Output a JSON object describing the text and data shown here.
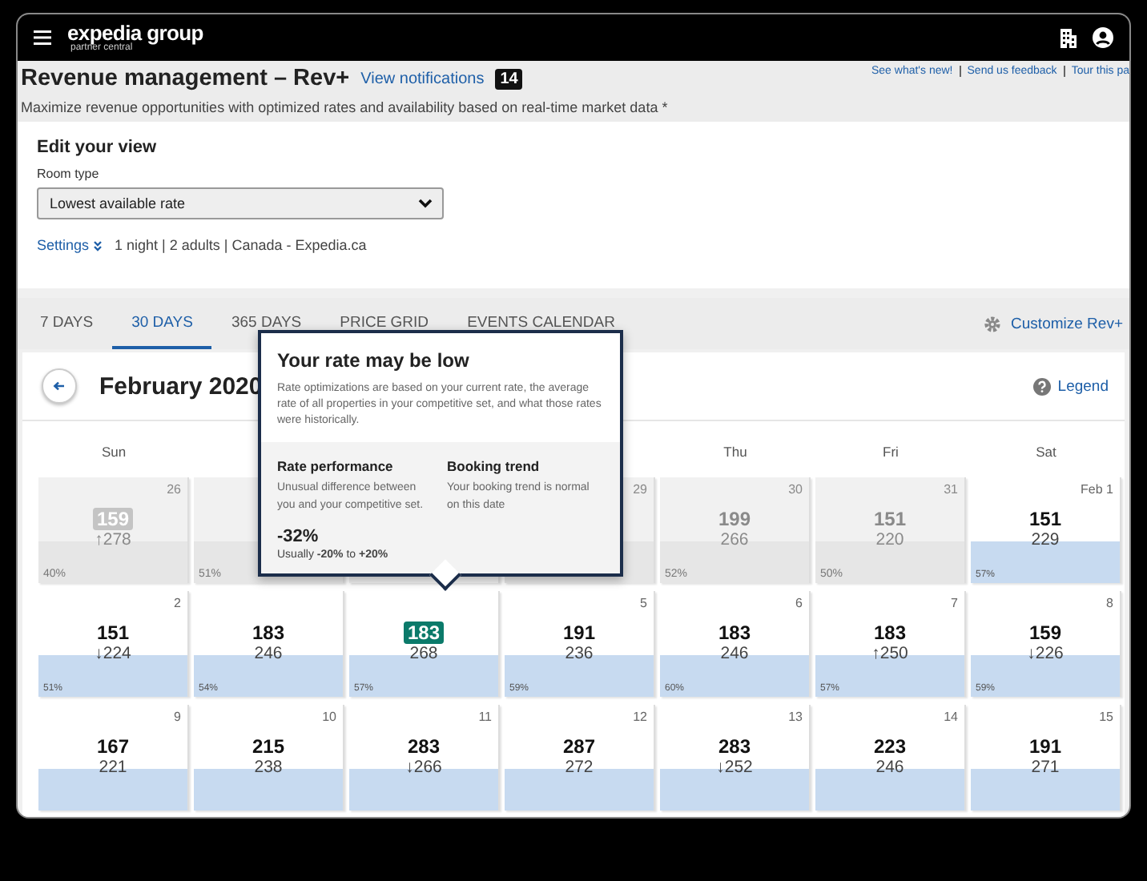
{
  "topbar": {
    "logo": "expedia group",
    "sublabel": "partner central"
  },
  "header": {
    "title": "Revenue management – Rev+",
    "notifications_link": "View notifications",
    "notifications_count": "14",
    "links": [
      "See what's new!",
      "Send us feedback",
      "Tour this pa"
    ],
    "subtitle": "Maximize revenue opportunities with optimized rates and availability based on real-time market data *"
  },
  "edit_view": {
    "title": "Edit your view",
    "room_type_label": "Room type",
    "room_type_value": "Lowest available rate",
    "settings_link": "Settings",
    "settings_summary": "1 night | 2 adults | Canada - Expedia.ca"
  },
  "tabs": [
    {
      "label": "7 DAYS",
      "selected": false
    },
    {
      "label": "30 DAYS",
      "selected": true
    },
    {
      "label": "365 DAYS",
      "selected": false
    },
    {
      "label": "PRICE GRID",
      "selected": false
    },
    {
      "label": "EVENTS CALENDAR",
      "selected": false
    }
  ],
  "customize_link": "Customize Rev+",
  "month": "February 2020",
  "legend_link": "Legend",
  "weekdays": {
    "left": [
      "Sun"
    ],
    "right": [
      "Thu",
      "Fri",
      "Sat"
    ]
  },
  "weeks": [
    [
      {
        "day": "26",
        "rate": "159",
        "flagged": true,
        "comp": "↑278",
        "pct": "40%",
        "outside": true
      },
      {
        "pct": "51%",
        "outside": true
      },
      {
        "day": "29",
        "outside": true,
        "gap_before": true
      },
      {
        "day": "30",
        "rate": "199",
        "flagged": false,
        "comp": "266",
        "pct": "52%",
        "outside": true
      },
      {
        "day": "31",
        "rate": "151",
        "flagged": false,
        "comp": "220",
        "pct": "50%",
        "outside": true
      },
      {
        "day": "Feb 1",
        "rate": "151",
        "flagged": false,
        "comp": "229",
        "pct": "57%",
        "outside": false
      }
    ],
    [
      {
        "day": "2",
        "rate": "151",
        "flagged": false,
        "comp": "↓224",
        "pct": "51%",
        "outside": false
      },
      {
        "rate": "183",
        "flagged": false,
        "comp": "246",
        "pct": "54%",
        "outside": false
      },
      {
        "rate": "183",
        "flagged": true,
        "comp": "268",
        "pct": "57%",
        "outside": false
      },
      {
        "day": "5",
        "rate": "191",
        "flagged": false,
        "comp": "236",
        "pct": "59%",
        "outside": false
      },
      {
        "day": "6",
        "rate": "183",
        "flagged": false,
        "comp": "246",
        "pct": "60%",
        "outside": false
      },
      {
        "day": "7",
        "rate": "183",
        "flagged": false,
        "comp": "↑250",
        "pct": "57%",
        "outside": false
      },
      {
        "day": "8",
        "rate": "159",
        "flagged": false,
        "comp": "↓226",
        "pct": "59%",
        "outside": false
      }
    ],
    [
      {
        "day": "9",
        "rate": "167",
        "flagged": false,
        "comp": "221",
        "outside": false
      },
      {
        "day": "10",
        "rate": "215",
        "flagged": false,
        "comp": "238",
        "outside": false
      },
      {
        "day": "11",
        "rate": "283",
        "flagged": false,
        "comp": "↓266",
        "outside": false
      },
      {
        "day": "12",
        "rate": "287",
        "flagged": false,
        "comp": "272",
        "outside": false
      },
      {
        "day": "13",
        "rate": "283",
        "flagged": false,
        "comp": "↓252",
        "outside": false
      },
      {
        "day": "14",
        "rate": "223",
        "flagged": false,
        "comp": "246",
        "outside": false
      },
      {
        "day": "15",
        "rate": "191",
        "flagged": false,
        "comp": "271",
        "outside": false
      }
    ]
  ],
  "tooltip": {
    "title": "Your rate may be low",
    "description": "Rate optimizations are based on your current rate, the average rate of all properties in your competitive set, and what those rates were historically.",
    "rate_heading": "Rate performance",
    "rate_text": "Unusual difference between you and your competitive set.",
    "rate_value": "-32%",
    "rate_usual": "Usually **-20%** to **+20%**",
    "trend_heading": "Booking trend",
    "trend_text": "Your booking trend is normal on this date"
  }
}
